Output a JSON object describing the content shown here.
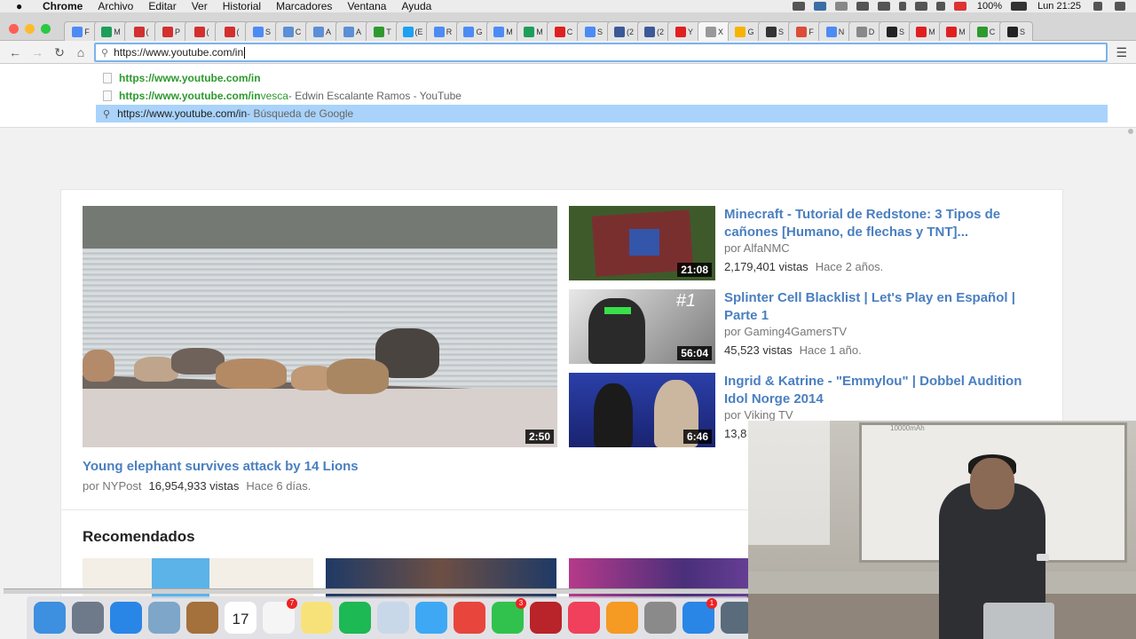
{
  "menubar": {
    "app": "Chrome",
    "items": [
      "Archivo",
      "Editar",
      "Ver",
      "Historial",
      "Marcadores",
      "Ventana",
      "Ayuda"
    ],
    "battery": "100%",
    "clock": "Lun 21:25"
  },
  "tabs": [
    {
      "label": "F",
      "color": "#4c8bf5"
    },
    {
      "label": "M",
      "color": "#1e9e5a"
    },
    {
      "label": "(",
      "color": "#d32f2f"
    },
    {
      "label": "P",
      "color": "#d32f2f"
    },
    {
      "label": "(",
      "color": "#d32f2f"
    },
    {
      "label": "(",
      "color": "#d32f2f"
    },
    {
      "label": "S",
      "color": "#4c8bf5"
    },
    {
      "label": "C",
      "color": "#5b8fd6"
    },
    {
      "label": "A",
      "color": "#5b8fd6"
    },
    {
      "label": "A",
      "color": "#5b8fd6"
    },
    {
      "label": "T",
      "color": "#2e9a2e"
    },
    {
      "label": "(E",
      "color": "#1da1f2"
    },
    {
      "label": "R",
      "color": "#4c8bf5"
    },
    {
      "label": "G",
      "color": "#4c8bf5"
    },
    {
      "label": "M",
      "color": "#4c8bf5"
    },
    {
      "label": "M",
      "color": "#1e9e5a"
    },
    {
      "label": "C",
      "color": "#e02020"
    },
    {
      "label": "S",
      "color": "#4c8bf5"
    },
    {
      "label": "(2",
      "color": "#3b5998"
    },
    {
      "label": "(2",
      "color": "#3b5998"
    },
    {
      "label": "Y",
      "color": "#e02020"
    },
    {
      "label": "X",
      "color": "#999999",
      "active": true
    },
    {
      "label": "G",
      "color": "#f4b400"
    },
    {
      "label": "S",
      "color": "#333333"
    },
    {
      "label": "F",
      "color": "#dd4b39"
    },
    {
      "label": "N",
      "color": "#4c8bf5"
    },
    {
      "label": "D",
      "color": "#888888"
    },
    {
      "label": "S",
      "color": "#222222"
    },
    {
      "label": "M",
      "color": "#e02020"
    },
    {
      "label": "M",
      "color": "#e02020"
    },
    {
      "label": "C",
      "color": "#2e9a2e"
    },
    {
      "label": "S",
      "color": "#222222"
    }
  ],
  "omnibox": {
    "value": "https://www.youtube.com/in"
  },
  "suggestions": [
    {
      "url": "https://www.youtube.com/in",
      "rest": "",
      "desc": ""
    },
    {
      "url": "https://www.youtube.com/in",
      "rest": "vesca",
      "desc": " - Edwin Escalante Ramos - YouTube"
    },
    {
      "url": "https://www.youtube.com/in",
      "rest": "",
      "desc": " - Búsqueda de Google"
    }
  ],
  "featured": {
    "title": "Young elephant survives attack by 14 Lions",
    "channel": "por NYPost",
    "views": "16,954,933 vistas",
    "age": "Hace 6 días.",
    "duration": "2:50"
  },
  "side_videos": [
    {
      "title": "Minecraft - Tutorial de Redstone: 3 Tipos de cañones [Humano, de flechas y TNT]...",
      "channel": "por AlfaNMC",
      "views": "2,179,401 vistas",
      "age": "Hace 2 años.",
      "duration": "21:08"
    },
    {
      "title": "Splinter Cell Blacklist | Let's Play en Español | Parte 1",
      "channel": "por Gaming4GamersTV",
      "views": "45,523 vistas",
      "age": "Hace 1 año.",
      "duration": "56:04",
      "badge": "#1"
    },
    {
      "title": "Ingrid & Katrine - \"Emmylou\" | Dobbel Audition Idol Norge 2014",
      "channel": "por Viking TV",
      "views": "13,8",
      "age": "",
      "duration": "6:46"
    }
  ],
  "recommended": {
    "title": "Recomendados"
  },
  "dock": {
    "icons": [
      {
        "name": "finder-icon",
        "color": "#3d8fe0"
      },
      {
        "name": "launchpad-icon",
        "color": "#6e7a8a"
      },
      {
        "name": "safari-icon",
        "color": "#2a86e6"
      },
      {
        "name": "preview-icon",
        "color": "#7da6c9"
      },
      {
        "name": "contacts-icon",
        "color": "#a4703b"
      },
      {
        "name": "calendar-icon",
        "color": "#ffffff",
        "label": "17"
      },
      {
        "name": "reminders-icon",
        "color": "#f5f5f5",
        "badge": "7"
      },
      {
        "name": "notes-icon",
        "color": "#f7e27a"
      },
      {
        "name": "spotify-icon",
        "color": "#1db954"
      },
      {
        "name": "photo-icon",
        "color": "#c8d8e8"
      },
      {
        "name": "messages-icon",
        "color": "#3ea8f5"
      },
      {
        "name": "chrome-icon",
        "color": "#e8453c"
      },
      {
        "name": "facetime-icon",
        "color": "#31c24d",
        "badge": "3"
      },
      {
        "name": "photobooth-icon",
        "color": "#b8242a"
      },
      {
        "name": "itunes-icon",
        "color": "#f0405b"
      },
      {
        "name": "ibooks-icon",
        "color": "#f59a23"
      },
      {
        "name": "calculator-icon",
        "color": "#8a8a8a"
      },
      {
        "name": "appstore-icon",
        "color": "#2a86e6",
        "badge": "1"
      },
      {
        "name": "imovie-icon",
        "color": "#5a6b7c"
      }
    ]
  },
  "webcam": {
    "board_text": "10000mAh"
  }
}
